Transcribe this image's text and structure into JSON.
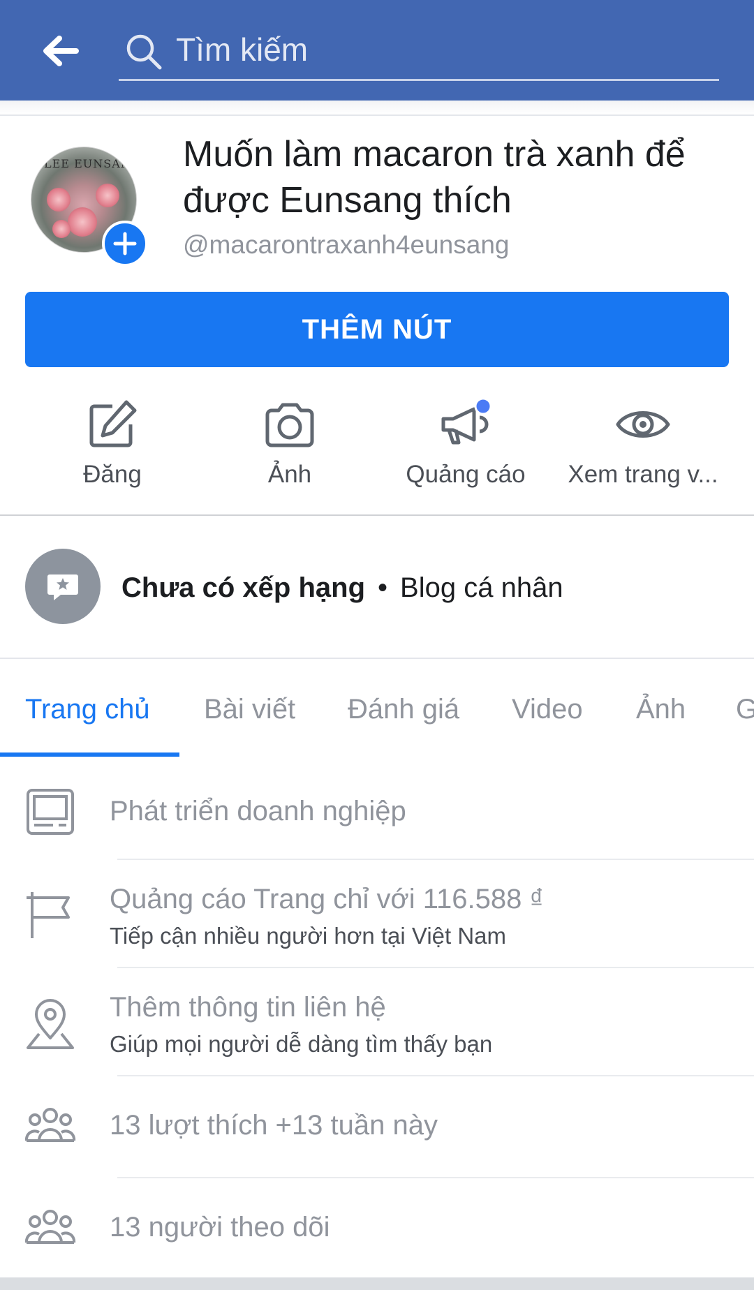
{
  "search": {
    "placeholder": "Tìm kiếm"
  },
  "profile": {
    "name": "Muốn làm macaron trà xanh để được Eunsang thích",
    "username": "@macarontraxanh4eunsang",
    "avatar_text": "LEE EUNSANG"
  },
  "primary_button": {
    "label": "THÊM NÚT"
  },
  "actions": [
    {
      "label": "Đăng",
      "icon": "edit-icon"
    },
    {
      "label": "Ảnh",
      "icon": "camera-icon"
    },
    {
      "label": "Quảng cáo",
      "icon": "megaphone-icon",
      "badge_color": "#4b7bf5"
    },
    {
      "label": "Xem trang v...",
      "icon": "eye-icon"
    }
  ],
  "rating": {
    "status": "Chưa có xếp hạng",
    "separator": "•",
    "category": "Blog cá nhân"
  },
  "tabs": [
    {
      "label": "Trang chủ",
      "active": true
    },
    {
      "label": "Bài viết"
    },
    {
      "label": "Đánh giá"
    },
    {
      "label": "Video"
    },
    {
      "label": "Ảnh"
    },
    {
      "label": "G"
    }
  ],
  "info": [
    {
      "title": "Phát triển doanh nghiệp",
      "icon": "monitor-icon"
    },
    {
      "title": "Quảng cáo Trang chỉ với 116.588 ₫",
      "subtitle": "Tiếp cận nhiều người hơn tại Việt Nam",
      "icon": "flag-icon"
    },
    {
      "title": "Thêm thông tin liên hệ",
      "subtitle": "Giúp mọi người dễ dàng tìm thấy bạn",
      "icon": "location-pin-icon"
    },
    {
      "title": "13 lượt thích +13 tuần này",
      "icon": "people-icon"
    },
    {
      "title": "13 người theo dõi",
      "icon": "people-icon"
    }
  ],
  "colors": {
    "header": "#4267b2",
    "accent": "#1877f2",
    "muted_text": "#90949c"
  }
}
